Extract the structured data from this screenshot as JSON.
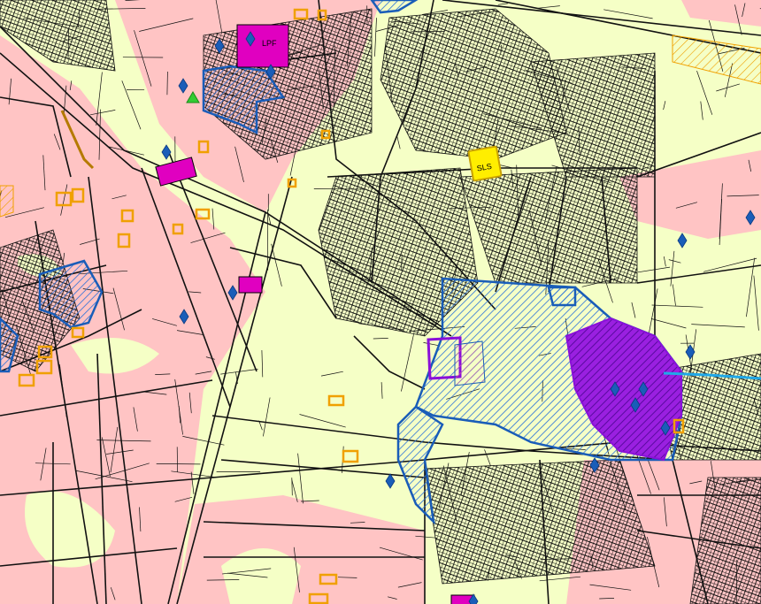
{
  "map": {
    "colors": {
      "background": "#f5ffc6",
      "pink_zone": "#ffc4c4",
      "road_line": "#111111",
      "blue_outline": "#1a5db8",
      "blue_hatch": "#2a70d8",
      "magenta_fill": "#e000c0",
      "purple_fill": "#8a10d8",
      "orange_marker": "#f0a000",
      "yellow_marker": "#ffee00",
      "water_line": "#20a8e8",
      "green_marker": "#33cc33"
    },
    "layers": [
      "pink-zones",
      "road-network",
      "dense-built-areas",
      "blue-heritage-zones",
      "purple-center",
      "orange-markers",
      "blue-diamond-markers",
      "water-line"
    ],
    "marker_labels": [
      "LPF",
      "SLS"
    ]
  }
}
